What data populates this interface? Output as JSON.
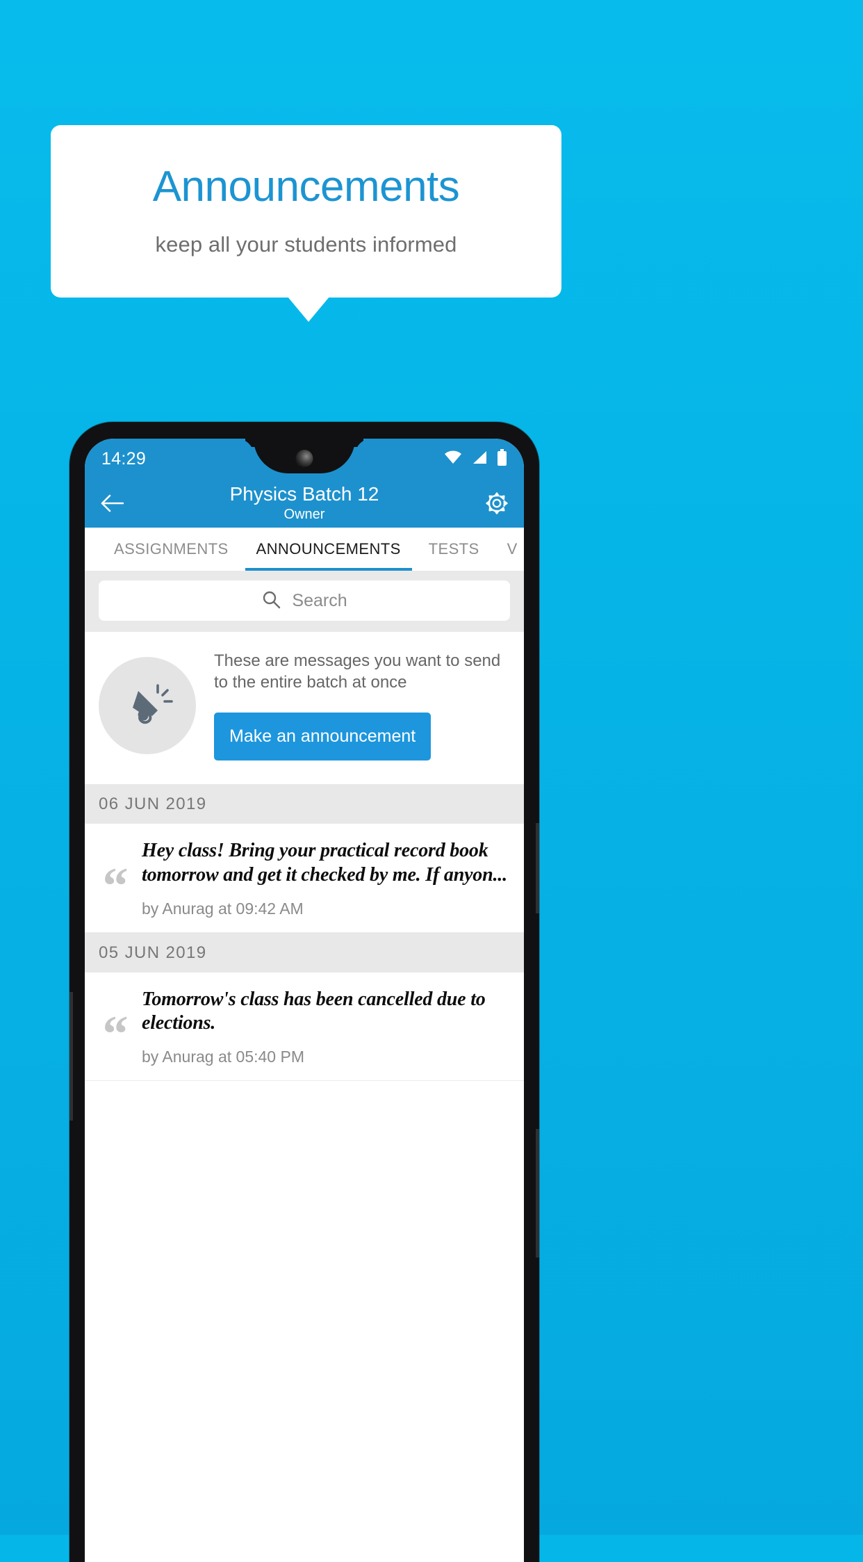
{
  "promo": {
    "title": "Announcements",
    "subtitle": "keep all your students informed",
    "accent_color": "#1c94d2",
    "background_color": "#06b3e6"
  },
  "phone": {
    "statusbar": {
      "time": "14:29",
      "icons": [
        "wifi-icon",
        "signal-icon",
        "battery-icon"
      ]
    },
    "appbar": {
      "back_icon": "back-arrow-icon",
      "title": "Physics Batch 12",
      "subtitle": "Owner",
      "settings_icon": "gear-icon",
      "color": "#1d91cd"
    },
    "tabs": [
      {
        "label": "ASSIGNMENTS",
        "active": false
      },
      {
        "label": "ANNOUNCEMENTS",
        "active": true
      },
      {
        "label": "TESTS",
        "active": false
      },
      {
        "label": "V",
        "active": false
      }
    ],
    "search": {
      "placeholder": "Search",
      "value": "",
      "icon": "search-icon"
    },
    "empty_state": {
      "icon": "megaphone-icon",
      "text": "These are messages you want to send to the entire batch at once",
      "button_label": "Make an announcement",
      "button_color": "#1d96dd"
    },
    "groups": [
      {
        "date": "06  JUN  2019",
        "items": [
          {
            "text": "Hey class! Bring your practical record book tomorrow and get it checked by me. If anyon...",
            "meta": "by Anurag at 09:42 AM"
          }
        ]
      },
      {
        "date": "05  JUN  2019",
        "items": [
          {
            "text": "Tomorrow's class has been cancelled due to elections.",
            "meta": "by Anurag at 05:40 PM"
          }
        ]
      }
    ]
  }
}
